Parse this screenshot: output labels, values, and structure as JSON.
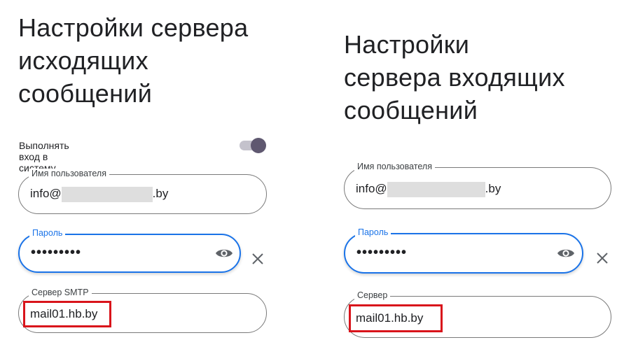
{
  "left": {
    "title_lines": [
      "Настройки сервера",
      "исходящих",
      "сообщений"
    ],
    "login_toggle": {
      "label": "Выполнять вход в систему",
      "on": true
    },
    "username": {
      "label": "Имя пользователя",
      "prefix": "info@",
      "suffix": ".by"
    },
    "password": {
      "label": "Пароль",
      "value": "•••••••••"
    },
    "server": {
      "label": "Сервер SMTP",
      "value": "mail01.hb.by"
    }
  },
  "right": {
    "title_lines": [
      "Настройки",
      "сервера входящих",
      "сообщений"
    ],
    "username": {
      "label": "Имя пользователя",
      "prefix": "info@",
      "suffix": ".by"
    },
    "password": {
      "label": "Пароль",
      "value": "•••••••••"
    },
    "server": {
      "label": "Сервер",
      "value": "mail01.hb.by"
    }
  },
  "colors": {
    "focus": "#1a73e8",
    "highlight": "#d9141b",
    "toggle_knob": "#5f5870"
  },
  "icons": [
    "eye-icon",
    "close-icon"
  ]
}
